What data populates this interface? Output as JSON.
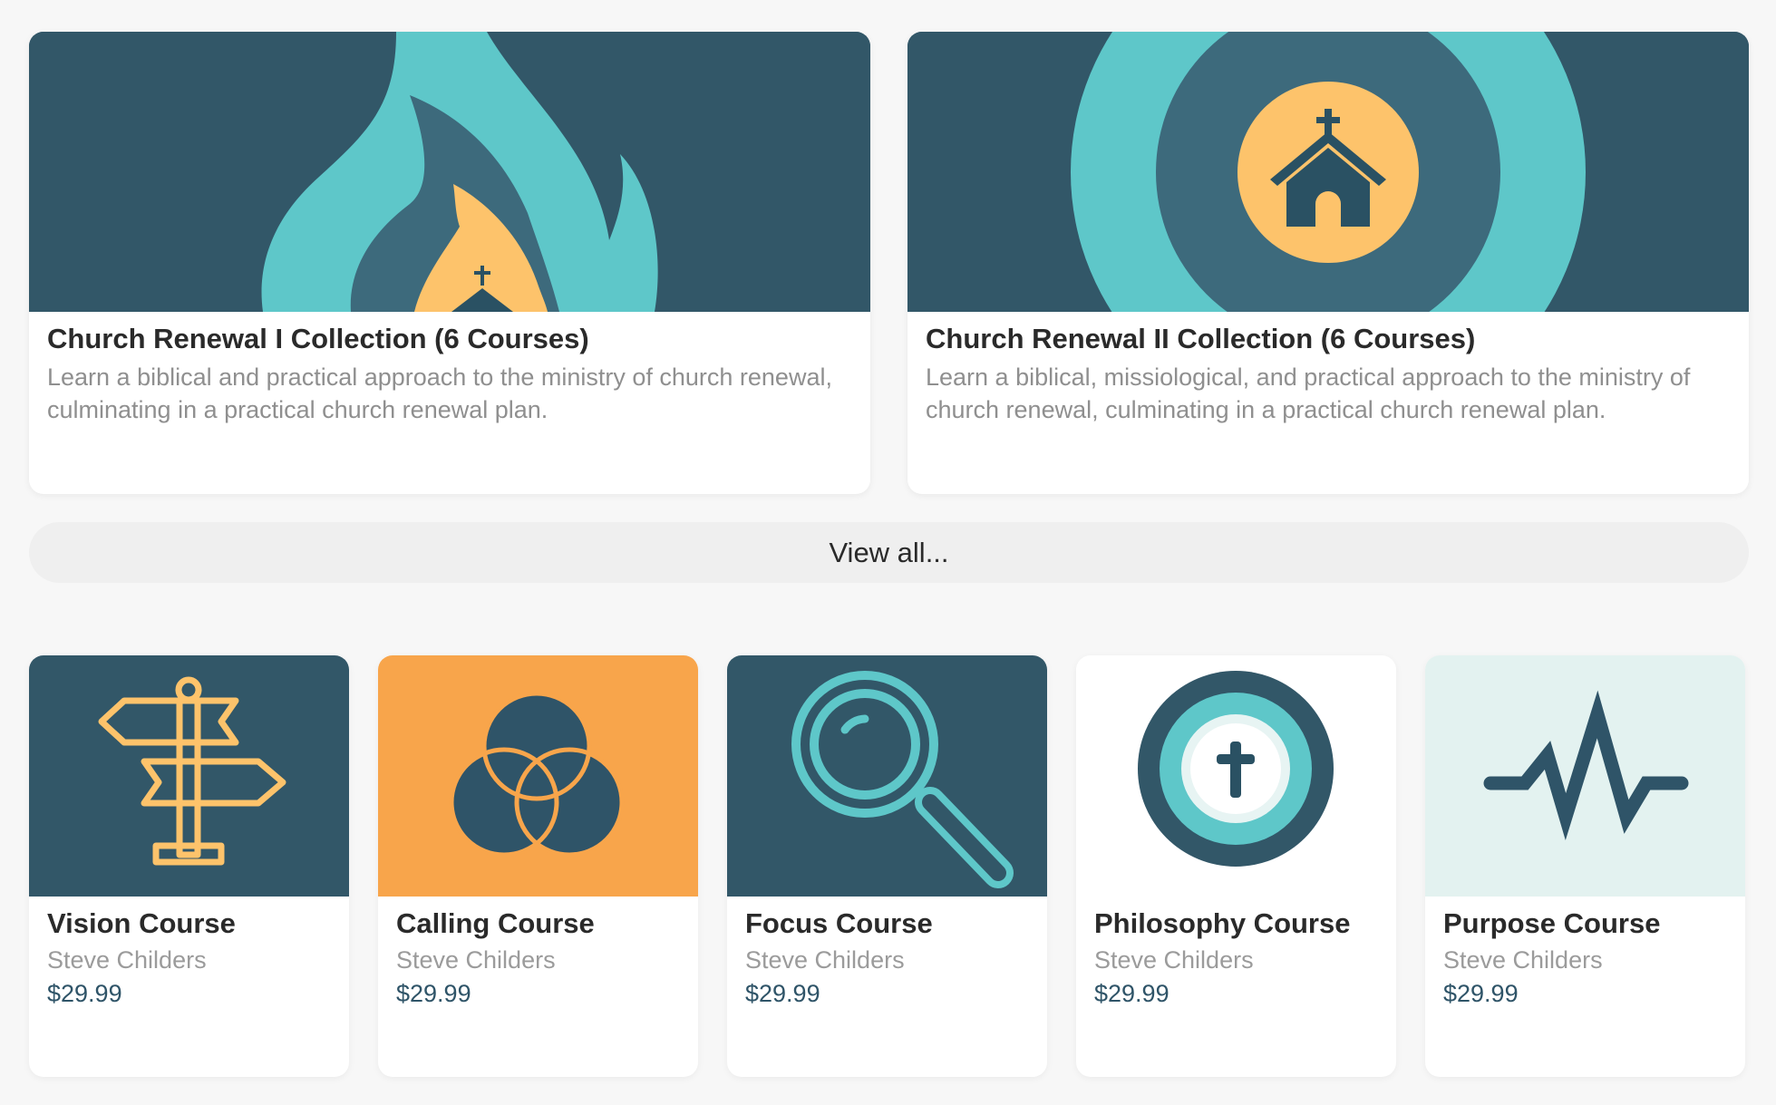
{
  "collections": [
    {
      "title": "Church Renewal I Collection (6 Courses)",
      "description": "Learn a biblical and practical approach to the ministry of church renewal, culminating in a practical church renewal plan.",
      "icon": "flame-church-icon"
    },
    {
      "title": "Church Renewal II Collection (6 Courses)",
      "description": "Learn a biblical, missiological, and practical approach to the ministry of church renewal, culminating in a practical church renewal plan.",
      "icon": "church-target-icon"
    }
  ],
  "view_all_label": "View all...",
  "courses": [
    {
      "title": "Vision Course",
      "author": "Steve Childers",
      "price": "$29.99",
      "icon": "signpost-icon",
      "bg": "#325768"
    },
    {
      "title": "Calling Course",
      "author": "Steve Childers",
      "price": "$29.99",
      "icon": "venn-circles-icon",
      "bg": "#f8a54b"
    },
    {
      "title": "Focus Course",
      "author": "Steve Childers",
      "price": "$29.99",
      "icon": "magnifying-glass-icon",
      "bg": "#325768"
    },
    {
      "title": "Philosophy Course",
      "author": "Steve Childers",
      "price": "$29.99",
      "icon": "cross-target-icon",
      "bg": "#ffffff"
    },
    {
      "title": "Purpose Course",
      "author": "Steve Childers",
      "price": "$29.99",
      "icon": "heartbeat-icon",
      "bg": "#e3f2f0"
    }
  ],
  "colors": {
    "navy": "#325768",
    "teal": "#5ec7c9",
    "gold": "#fdc36b",
    "orange": "#f8a54b",
    "price": "#2f5468"
  }
}
